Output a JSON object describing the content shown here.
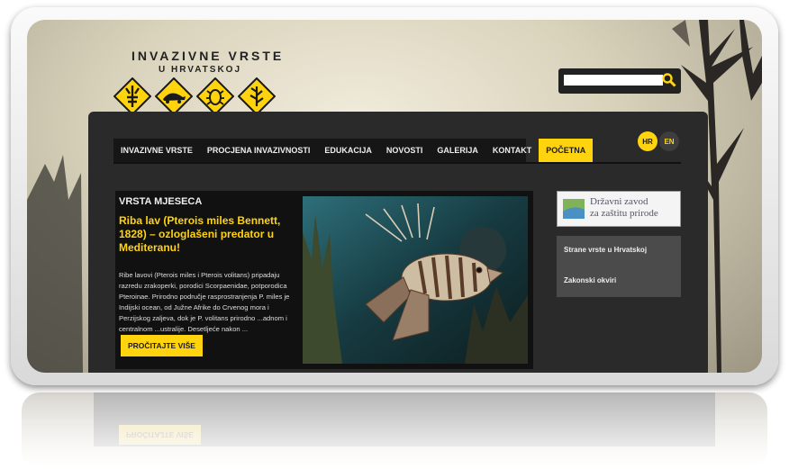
{
  "header": {
    "title": "INVAZIVNE VRSTE",
    "subtitle": "U HRVATSKOJ",
    "signs": [
      "lobster-icon",
      "turtle-icon",
      "beetle-icon",
      "plant-icon"
    ]
  },
  "search": {
    "value": "",
    "placeholder": ""
  },
  "nav": {
    "items": [
      {
        "label": "INVAZIVNE VRSTE"
      },
      {
        "label": "PROCJENA INVAZIVNOSTI"
      },
      {
        "label": "EDUKACIJA"
      },
      {
        "label": "NOVOSTI"
      },
      {
        "label": "GALERIJA"
      },
      {
        "label": "KONTAKT"
      },
      {
        "label": "POČETNA"
      }
    ],
    "active": "POČETNA"
  },
  "languages": {
    "hr": "HR",
    "en": "EN"
  },
  "featured": {
    "heading": "VRSTA MJESECA",
    "title": "Riba lav (Pterois miles Bennett, 1828) – ozloglašeni predator u Mediteranu!",
    "body": "Ribe lavovi (Pterois miles i Pterois volitans) pripadaju razredu zrakoperki, porodici Scorpaenidae, potporodica Pteroinae. Prirodno područje rasprostranjenja P. miles je Indijski ocean, od Južne Afrike do Crvenog mora i Perzijskog zaljeva, dok je P. volitans prirodno ...adnom i centralnom ...ustralije. Desetljeće nakon ...",
    "read_more": "PROČITAJTE VIŠE"
  },
  "sidebar": {
    "logo_text_1": "Državni zavod",
    "logo_text_2": "za zaštitu prirode",
    "links": [
      {
        "label": "Strane vrste u Hrvatskoj"
      },
      {
        "label": "Zakonski okviri"
      }
    ]
  },
  "colors": {
    "accent": "#ffd40f",
    "panel": "#2a2a2a",
    "nav": "#161616"
  }
}
